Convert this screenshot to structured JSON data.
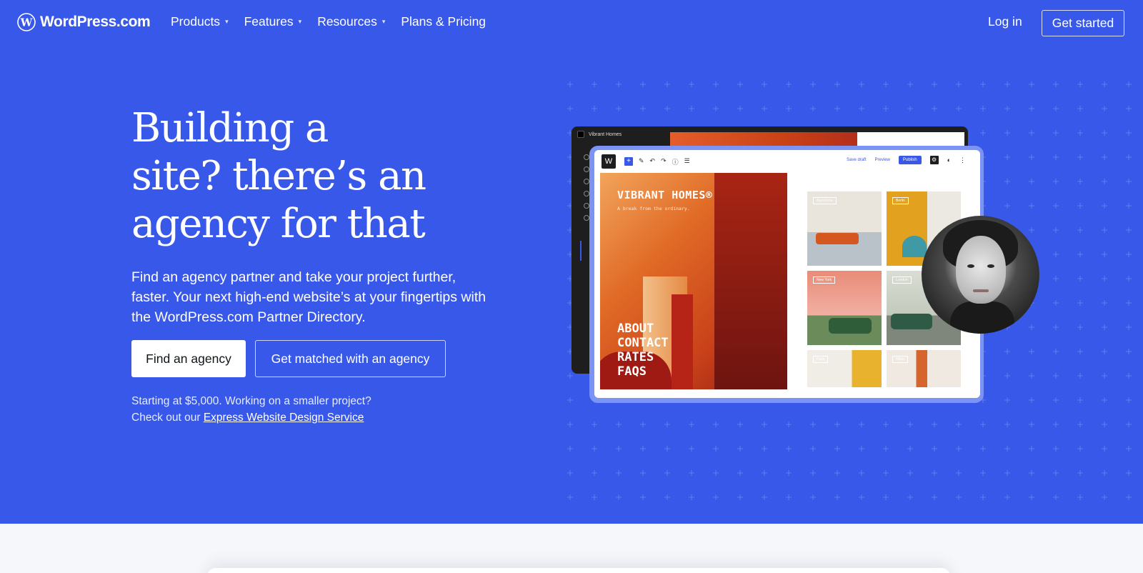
{
  "nav": {
    "logo_text": "WordPress.com",
    "items": [
      {
        "label": "Products",
        "caret": "▾"
      },
      {
        "label": "Features",
        "caret": "▾"
      },
      {
        "label": "Resources",
        "caret": "▾"
      },
      {
        "label": "Plans & Pricing",
        "caret": ""
      }
    ],
    "login": "Log in",
    "get_started": "Get started"
  },
  "hero": {
    "headline_1": "Building a",
    "headline_2": "site? there’s an",
    "headline_3": "agency for that",
    "subcopy": "Find an agency partner and take your project further, faster. Your next high-end website’s at your fingertips with the WordPress.com Partner Directory.",
    "primary_button": "Find an agency",
    "secondary_button": "Get matched with an agency",
    "note_line_1": "Starting at $5,000. Working on a smaller project?",
    "note_prefix": "Check out our",
    "note_link": "Express Website Design Service"
  },
  "mockup": {
    "dark_title": "Vibrant Homes",
    "save_draft": "Save draft",
    "preview": "Preview",
    "publish": "Publish",
    "poster_title": "VIBRANT HOMES®",
    "poster_tagline": "A break from the ordinary.",
    "poster_links": [
      "ABOUT",
      "CONTACT",
      "RATES",
      "FAQS"
    ],
    "thumb_labels": [
      "Barcelona",
      "Berlin",
      "New York",
      "London",
      "Paris",
      "Milan"
    ]
  },
  "colors": {
    "brand_blue": "#3858e9",
    "page_bg": "#f6f7fb"
  }
}
